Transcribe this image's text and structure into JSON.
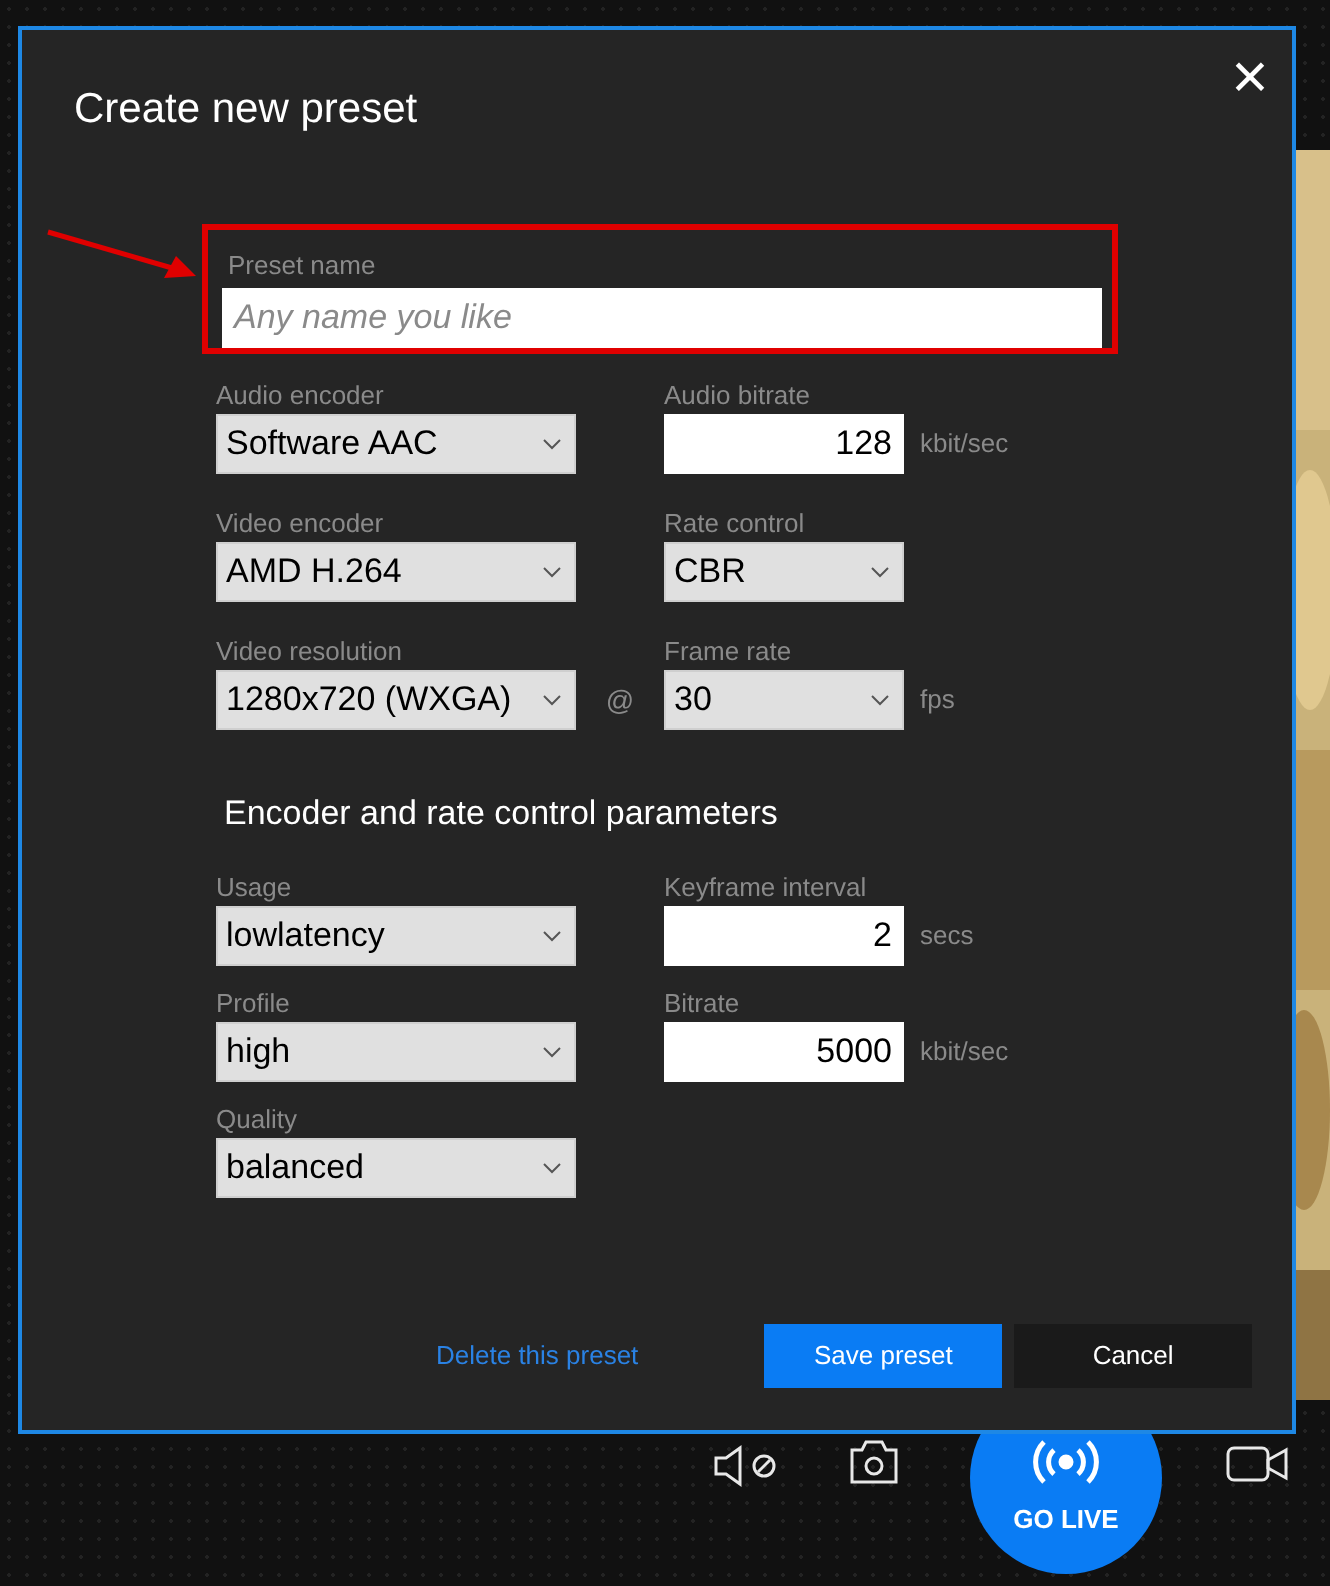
{
  "dialog": {
    "title": "Create new preset",
    "close": "×",
    "preset_name": {
      "label": "Preset name",
      "placeholder": "Any name you like",
      "highlighted": true
    },
    "general_rows": [
      {
        "left": {
          "label": "Audio encoder",
          "kind": "select",
          "value": "Software AAC"
        },
        "right": {
          "label": "Audio bitrate",
          "kind": "number",
          "value": "128",
          "unit": "kbit/sec"
        }
      },
      {
        "left": {
          "label": "Video encoder",
          "kind": "select",
          "value": "AMD H.264"
        },
        "right": {
          "label": "Rate control",
          "kind": "select",
          "value": "CBR"
        }
      },
      {
        "left": {
          "label": "Video resolution",
          "kind": "select",
          "value": "1280x720 (WXGA)"
        },
        "joiner": "@",
        "right": {
          "label": "Frame rate",
          "kind": "select",
          "value": "30",
          "unit": "fps"
        }
      }
    ],
    "section_title": "Encoder and rate control parameters",
    "parameter_rows": [
      {
        "left": {
          "label": "Usage",
          "kind": "select",
          "value": "lowlatency"
        },
        "right": {
          "label": "Keyframe interval",
          "kind": "number",
          "value": "2",
          "unit": "secs"
        }
      },
      {
        "left": {
          "label": "Profile",
          "kind": "select",
          "value": "high"
        },
        "right": {
          "label": "Bitrate",
          "kind": "number",
          "value": "5000",
          "unit": "kbit/sec"
        }
      },
      {
        "left": {
          "label": "Quality",
          "kind": "select",
          "value": "balanced"
        }
      }
    ],
    "delete_link": "Delete this preset",
    "buttons": [
      {
        "label": "Save preset",
        "kind": "primary"
      },
      {
        "label": "Cancel",
        "kind": "secondary"
      }
    ]
  },
  "toolbar": {
    "go_live": "GO LIVE"
  }
}
